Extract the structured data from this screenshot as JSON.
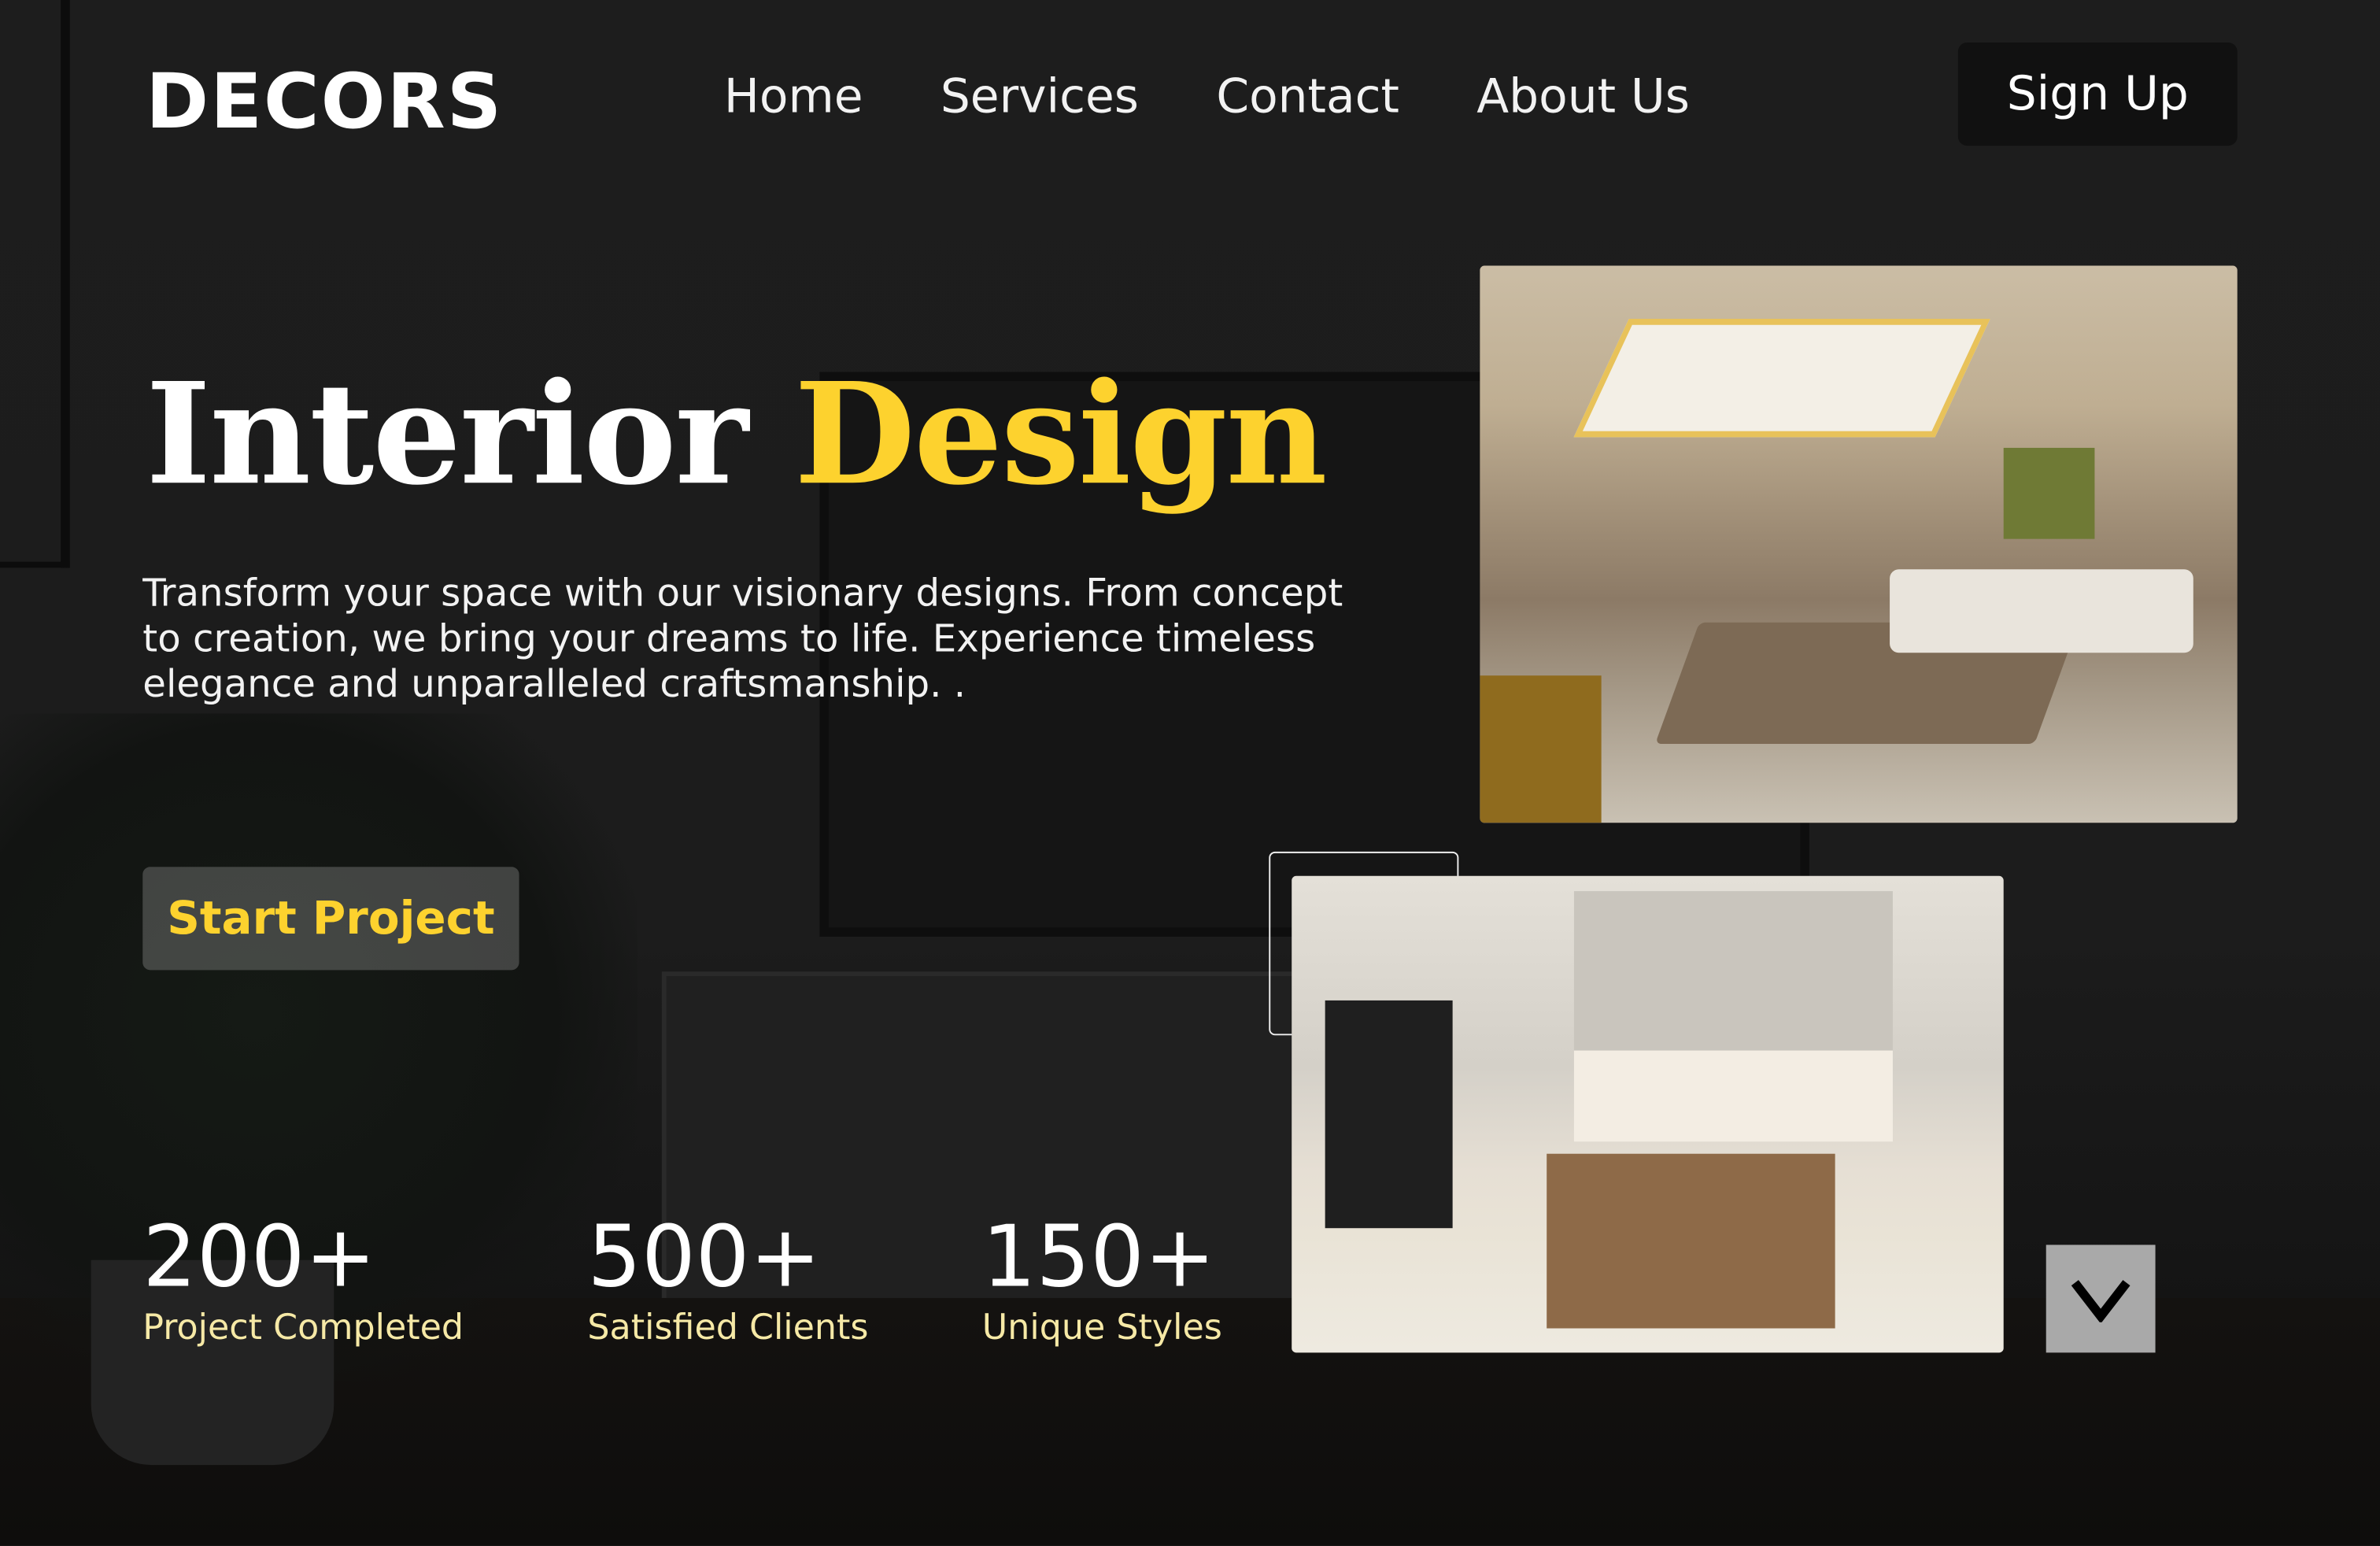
{
  "header": {
    "logo": "DECORS",
    "nav": [
      "Home",
      "Services",
      "Contact",
      "About Us"
    ],
    "signup_label": "Sign Up"
  },
  "hero": {
    "title_white": "Interior",
    "title_accent": "Design",
    "description": "Transform your space with our visionary designs. From concept to creation, we bring your dreams to life. Experience timeless elegance and unparalleled craftsmanship. .",
    "cta_label": "Start Project"
  },
  "stats": [
    {
      "value": "200+",
      "label": "Project Completed"
    },
    {
      "value": "500+",
      "label": "Satisfied Clients"
    },
    {
      "value": "150+",
      "label": "Unique Styles"
    }
  ],
  "gallery": {
    "icons": {
      "scroll": "chevron-down-icon"
    }
  },
  "colors": {
    "accent": "#fdd22e",
    "background": "#1b1b1b",
    "stat_label": "#f6e9a6"
  }
}
